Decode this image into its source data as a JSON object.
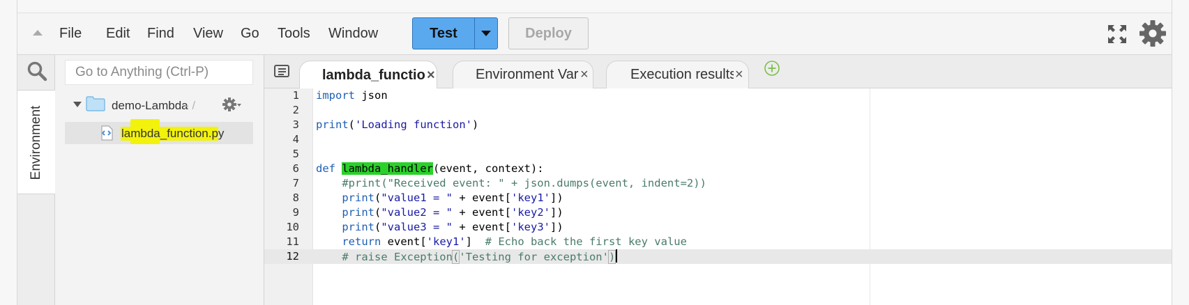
{
  "menubar": {
    "menus": [
      "File",
      "Edit",
      "Find",
      "View",
      "Go",
      "Tools",
      "Window"
    ],
    "test_label": "Test",
    "deploy_label": "Deploy"
  },
  "rail": {
    "tab_label": "Environment"
  },
  "tree": {
    "search_placeholder": "Go to Anything (Ctrl-P)",
    "folder_name": "demo-Lambda",
    "folder_sep": "- /",
    "file_name": "lambda_function.py"
  },
  "tabs": [
    {
      "label": "lambda_function",
      "close": "×",
      "active": true
    },
    {
      "label": "Environment Vari",
      "close": "×",
      "active": false
    },
    {
      "label": "Execution results",
      "close": "×",
      "active": false
    }
  ],
  "editor": {
    "current_line": 12,
    "line_numbers": [
      "1",
      "2",
      "3",
      "4",
      "5",
      "6",
      "7",
      "8",
      "9",
      "10",
      "11",
      "12"
    ],
    "lines": [
      "import json",
      "",
      "print('Loading function')",
      "",
      "",
      "def lambda_handler(event, context):",
      "    #print(\"Received event: \" + json.dumps(event, indent=2))",
      "    print(\"value1 = \" + event['key1'])",
      "    print(\"value2 = \" + event['key2'])",
      "    print(\"value3 = \" + event['key3'])",
      "    return event['key1']  # Echo back the first key value",
      "    # raise Exception('Testing for exception')"
    ]
  },
  "colors": {
    "test_button": "#5aa9ef",
    "highlight_yellow": "#f2f20c",
    "highlight_green": "#2ad12a",
    "keyword": "#1e5fb4",
    "comment": "#4a7b69"
  },
  "icons": [
    "collapse-icon",
    "chevron-down-icon",
    "fullscreen-icon",
    "gear-icon",
    "search-icon",
    "folder-icon",
    "file-code-icon",
    "tabs-menu-icon",
    "add-tab-icon",
    "close-icon"
  ]
}
